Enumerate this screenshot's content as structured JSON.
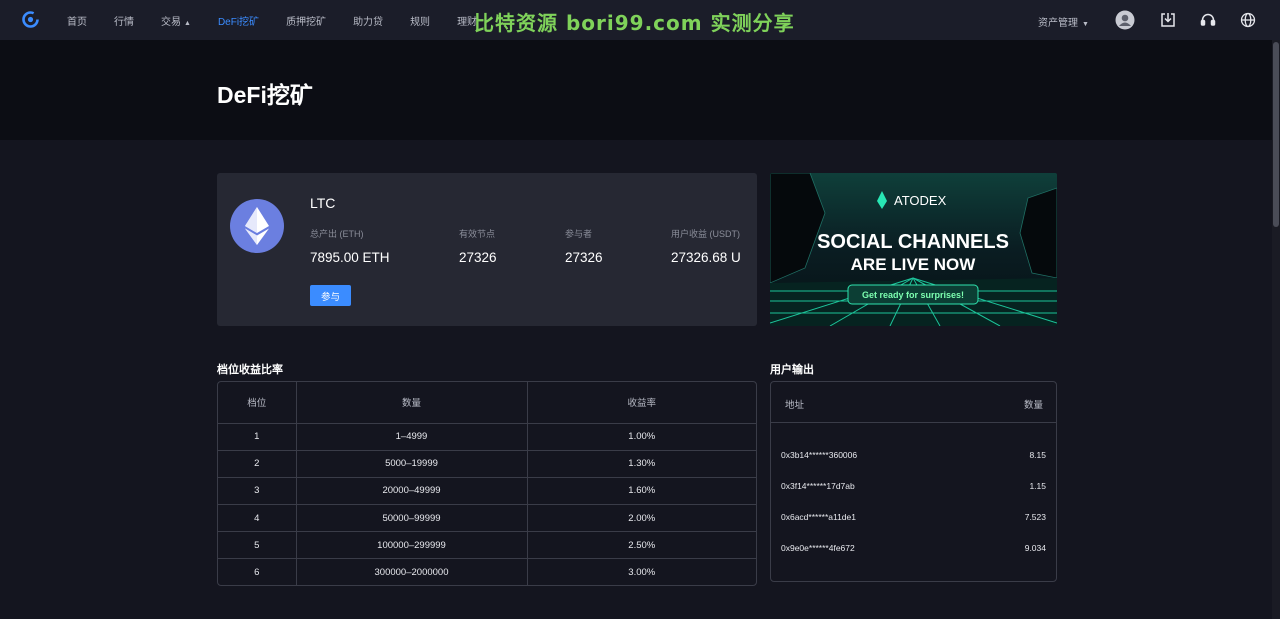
{
  "nav": {
    "items": [
      {
        "label": "首页",
        "caret": ""
      },
      {
        "label": "行情",
        "caret": ""
      },
      {
        "label": "交易",
        "caret": "▲"
      },
      {
        "label": "DeFi挖矿",
        "caret": ""
      },
      {
        "label": "质押挖矿",
        "caret": ""
      },
      {
        "label": "助力贷",
        "caret": ""
      },
      {
        "label": "规则",
        "caret": ""
      },
      {
        "label": "理财",
        "caret": ""
      }
    ],
    "watermark": "比特资源 bori99.com 实测分享",
    "assets_label": "资产管理",
    "assets_caret": "▼",
    "accent": "#3b8cff"
  },
  "page": {
    "title": "DeFi挖矿"
  },
  "pool": {
    "coin": "LTC",
    "stats": [
      {
        "label": "总产出 (ETH)",
        "value": "7895.00 ETH"
      },
      {
        "label": "有效节点",
        "value": "27326"
      },
      {
        "label": "参与者",
        "value": "27326"
      },
      {
        "label": "用户收益 (USDT)",
        "value": "27326.68 U"
      }
    ],
    "join_label": "参与"
  },
  "banner": {
    "brand": "ATODEX",
    "line1": "SOCIAL CHANNELS",
    "line2": "ARE LIVE NOW",
    "cta": "Get ready for surprises!"
  },
  "tiers": {
    "title": "档位收益比率",
    "headers": [
      "档位",
      "数量",
      "收益率"
    ],
    "rows": [
      [
        "1",
        "1–4999",
        "1.00%"
      ],
      [
        "2",
        "5000–19999",
        "1.30%"
      ],
      [
        "3",
        "20000–49999",
        "1.60%"
      ],
      [
        "4",
        "50000–99999",
        "2.00%"
      ],
      [
        "5",
        "100000–299999",
        "2.50%"
      ],
      [
        "6",
        "300000–2000000",
        "3.00%"
      ]
    ]
  },
  "output": {
    "title": "用户输出",
    "headers": [
      "地址",
      "数量"
    ],
    "rows": [
      [
        "0x3b14******360006",
        "8.15"
      ],
      [
        "0x3f14******17d7ab",
        "1.15"
      ],
      [
        "0x6acd******a11de1",
        "7.523"
      ],
      [
        "0x9e0e******4fe672",
        "9.034"
      ]
    ]
  }
}
